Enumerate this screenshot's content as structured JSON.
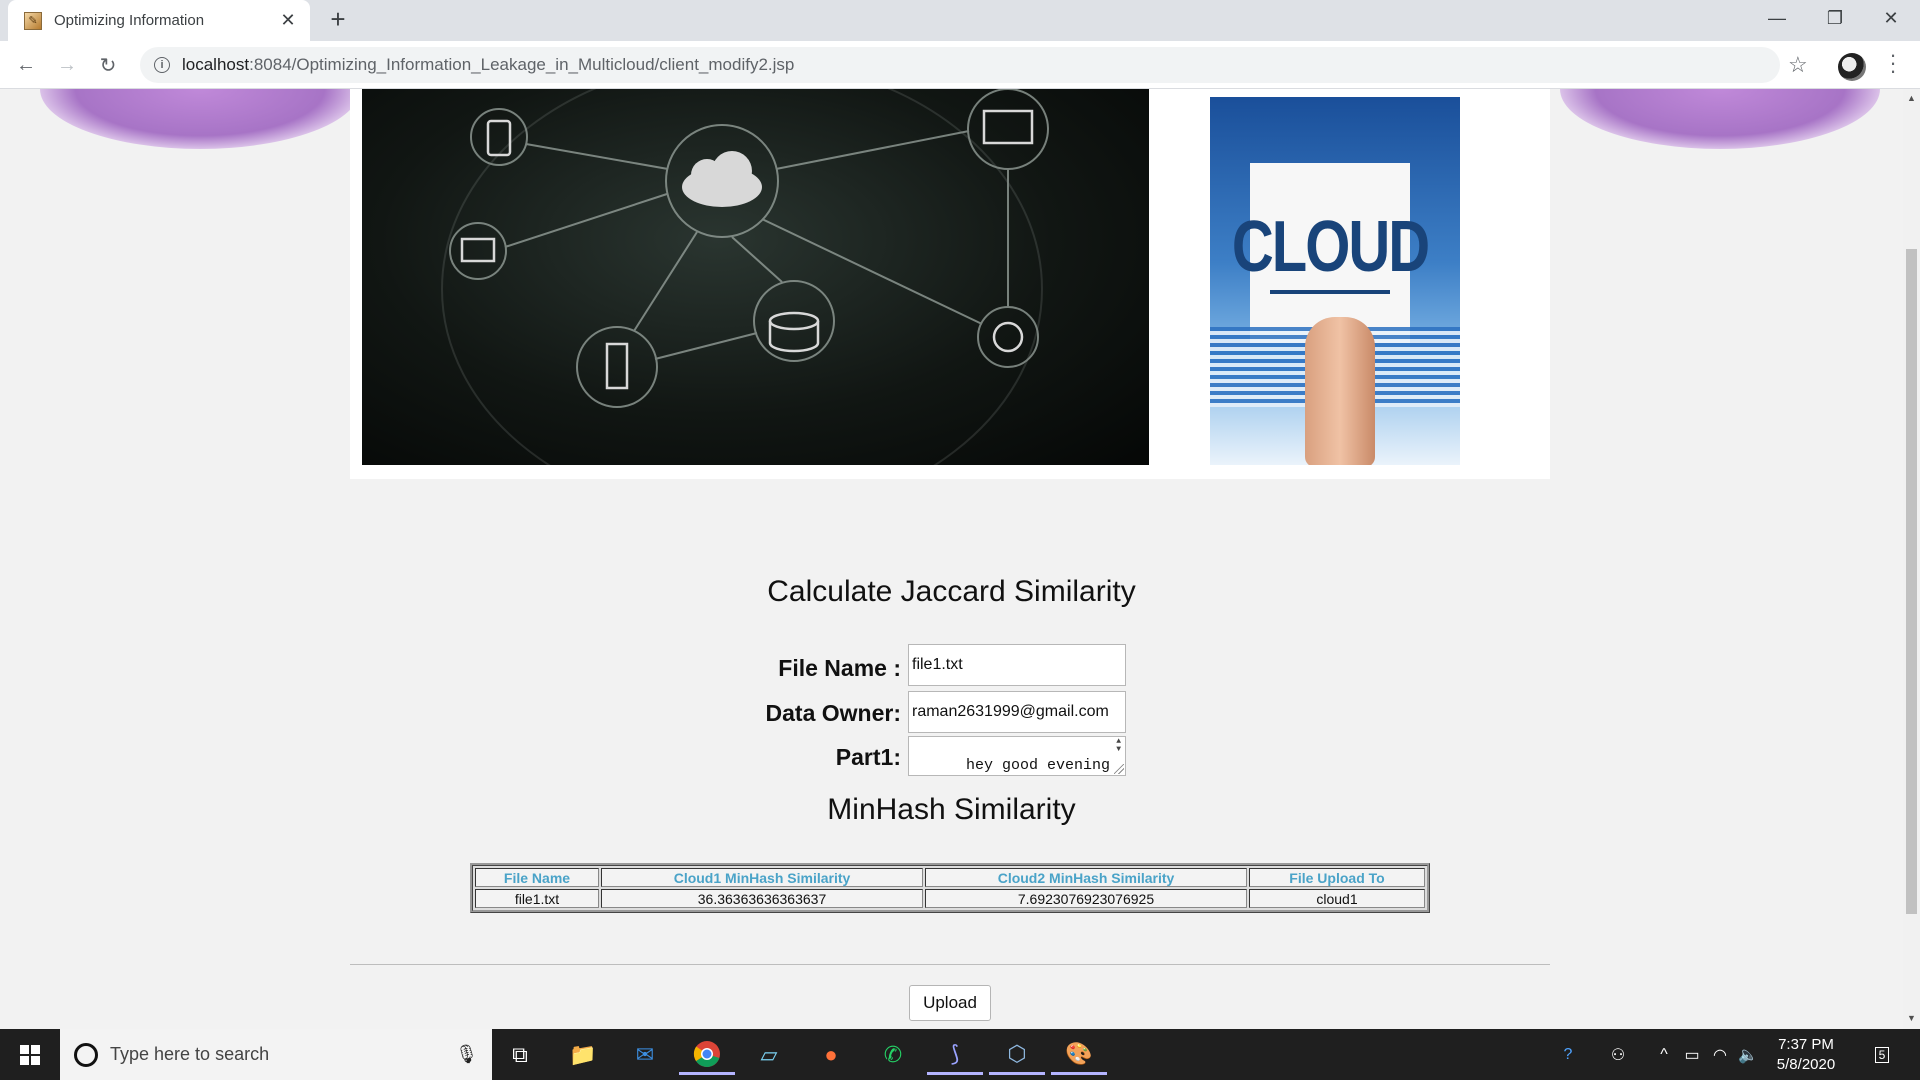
{
  "browser": {
    "tab_title": "Optimizing Information",
    "tab_close": "✕",
    "new_tab": "+",
    "url_host": "localhost",
    "url_path": ":8084/Optimizing_Information_Leakage_in_Multicloud/client_modify2.jsp",
    "window_controls": {
      "minimize": "—",
      "restore": "❐",
      "close": "✕"
    }
  },
  "banner": {
    "cloud_word": "CLOUD"
  },
  "jaccard": {
    "title": "Calculate Jaccard Similarity",
    "file_name_label": "File Name :",
    "file_name_value": "file1.txt",
    "data_owner_label": "Data Owner:",
    "data_owner_value": "raman2631999@gmail.com",
    "part1_label": "Part1:",
    "part1_value": "hey good evening and here we can add"
  },
  "minhash": {
    "title": "MinHash Similarity",
    "columns": [
      "File Name",
      "Cloud1 MinHash Similarity",
      "Cloud2 MinHash Similarity",
      "File Upload To"
    ],
    "rows": [
      [
        "file1.txt",
        "36.36363636363637",
        "7.6923076923076925",
        "cloud1"
      ]
    ]
  },
  "upload_button": "Upload",
  "taskbar": {
    "search_placeholder": "Type here to search",
    "time": "7:37 PM",
    "date": "5/8/2020",
    "notification_count": "5"
  }
}
